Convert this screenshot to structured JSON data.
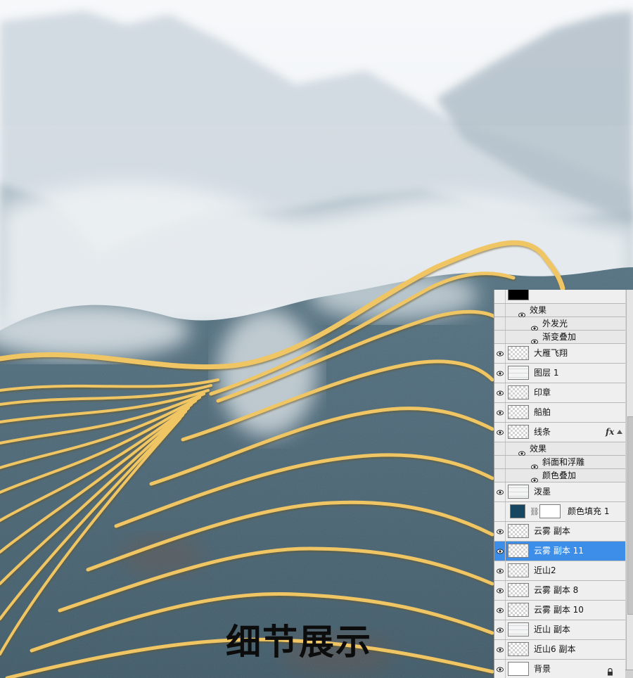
{
  "caption": "细节展示",
  "layers_panel": {
    "rows": [
      {
        "kind": "layer",
        "label": "",
        "thumb": "black",
        "eye": false
      },
      {
        "kind": "sub",
        "label": "效果",
        "indent": 1
      },
      {
        "kind": "sub",
        "label": "外发光",
        "indent": 2
      },
      {
        "kind": "sub",
        "label": "渐变叠加",
        "indent": 2
      },
      {
        "kind": "layer",
        "label": "大雁飞翔",
        "thumb": "checker",
        "eye": true
      },
      {
        "kind": "layer",
        "label": "图层 1",
        "thumb": "sketch",
        "eye": true
      },
      {
        "kind": "layer",
        "label": "印章",
        "thumb": "checker",
        "eye": true
      },
      {
        "kind": "layer",
        "label": "船舶",
        "thumb": "checker",
        "eye": true
      },
      {
        "kind": "layer",
        "label": "线条",
        "thumb": "checker",
        "eye": true,
        "fx": "fx"
      },
      {
        "kind": "sub",
        "label": "效果",
        "indent": 1
      },
      {
        "kind": "sub",
        "label": "斜面和浮雕",
        "indent": 2
      },
      {
        "kind": "sub",
        "label": "颜色叠加",
        "indent": 2
      },
      {
        "kind": "layer",
        "label": "泼墨",
        "thumb": "sketch",
        "eye": true
      },
      {
        "kind": "fill",
        "label": "颜色填充 1",
        "thumb": "dark",
        "mask": "white",
        "eye": false
      },
      {
        "kind": "layer",
        "label": "云雾 副本",
        "thumb": "checker",
        "eye": true
      },
      {
        "kind": "layer",
        "label": "云雾 副本 11",
        "thumb": "checker",
        "eye": true,
        "selected": true
      },
      {
        "kind": "layer",
        "label": "近山2",
        "thumb": "checker",
        "eye": true
      },
      {
        "kind": "layer",
        "label": "云雾 副本 8",
        "thumb": "checker",
        "eye": true
      },
      {
        "kind": "layer",
        "label": "云雾 副本 10",
        "thumb": "checker",
        "eye": true
      },
      {
        "kind": "layer",
        "label": "近山 副本",
        "thumb": "sketch",
        "eye": true
      },
      {
        "kind": "layer",
        "label": "近山6 副本",
        "thumb": "checker",
        "eye": true
      },
      {
        "kind": "layer",
        "label": "背景",
        "thumb": "white",
        "eye": true,
        "locked": true
      }
    ],
    "icons": {
      "visibility": "eye-icon",
      "effects": "fx-icon",
      "lock": "lock-icon",
      "link": "chain-link-icon"
    }
  },
  "colors": {
    "gold": "#f0c563",
    "ink_blue": "#4a6676",
    "mist": "#e8edf1",
    "selection": "#3d8ee8"
  }
}
